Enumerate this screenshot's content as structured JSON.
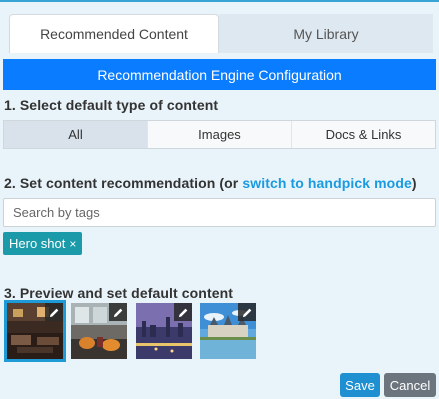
{
  "tabs": [
    {
      "label": "Recommended Content",
      "active": true
    },
    {
      "label": "My Library",
      "active": false
    }
  ],
  "banner": "Recommendation Engine Configuration",
  "step1": {
    "title": "1. Select default type of content"
  },
  "content_types": [
    {
      "label": "All",
      "selected": true
    },
    {
      "label": "Images",
      "selected": false
    },
    {
      "label": "Docs & Links",
      "selected": false
    }
  ],
  "step2": {
    "title_prefix": "2. Set content recommendation (or ",
    "link": "switch to handpick mode",
    "title_suffix": ")"
  },
  "search": {
    "placeholder": "Search by tags",
    "value": ""
  },
  "tags": [
    {
      "label": "Hero shot",
      "remove": "×"
    }
  ],
  "step3": {
    "title": "3. Preview and set default content"
  },
  "thumbnails": [
    {
      "subject": "hotel lobby interior",
      "selected": true,
      "icon": "pencil-icon"
    },
    {
      "subject": "restaurant lounge with orange chairs",
      "selected": false,
      "icon": "pencil-icon"
    },
    {
      "subject": "city skyline at dusk",
      "selected": false,
      "icon": "pencil-icon"
    },
    {
      "subject": "chateau with blue sky",
      "selected": false,
      "icon": "pencil-icon"
    }
  ],
  "actions": {
    "save": "Save",
    "cancel": "Cancel"
  },
  "colors": {
    "accent": "#0a7cff",
    "tag": "#1b9aaa",
    "link": "#1a9be0",
    "save": "#1e8fd0",
    "cancel": "#6c757d"
  }
}
